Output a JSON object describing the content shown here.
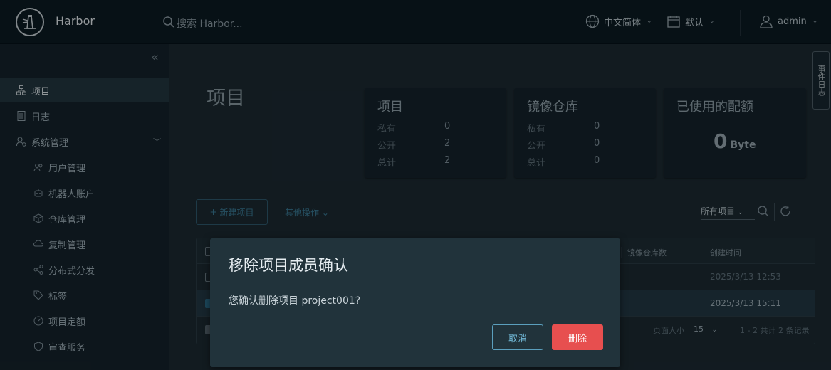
{
  "header": {
    "brand": "Harbor",
    "search_placeholder": "搜索 Harbor...",
    "language": "中文简体",
    "datetime_format": "默认",
    "user": "admin"
  },
  "sidebar": {
    "items": [
      {
        "label": "项目",
        "icon": "projects-icon",
        "active": true
      },
      {
        "label": "日志",
        "icon": "logs-icon"
      },
      {
        "label": "系统管理",
        "icon": "admin-icon",
        "expandable": true
      },
      {
        "label": "用户管理",
        "icon": "users-icon",
        "sub": true
      },
      {
        "label": "机器人账户",
        "icon": "robot-icon",
        "sub": true
      },
      {
        "label": "仓库管理",
        "icon": "registry-icon",
        "sub": true
      },
      {
        "label": "复制管理",
        "icon": "replication-icon",
        "sub": true
      },
      {
        "label": "分布式分发",
        "icon": "distribution-icon",
        "sub": true
      },
      {
        "label": "标签",
        "icon": "tag-icon",
        "sub": true
      },
      {
        "label": "项目定额",
        "icon": "quota-icon",
        "sub": true
      },
      {
        "label": "审查服务",
        "icon": "shield-icon",
        "sub": true
      }
    ]
  },
  "main": {
    "title": "项目",
    "cards": {
      "projects": {
        "title": "项目",
        "rows": [
          {
            "label": "私有",
            "value": "0"
          },
          {
            "label": "公开",
            "value": "2"
          },
          {
            "label": "总计",
            "value": "2"
          }
        ]
      },
      "repos": {
        "title": "镜像仓库",
        "rows": [
          {
            "label": "私有",
            "value": "0"
          },
          {
            "label": "公开",
            "value": "0"
          },
          {
            "label": "总计",
            "value": "0"
          }
        ]
      },
      "quota": {
        "title": "已使用的配额",
        "value": "0",
        "unit": "Byte"
      }
    },
    "new_project": "新建项目",
    "other_ops": "其他操作",
    "filter": "所有项目",
    "side_tab": "事件日志",
    "table": {
      "headers": [
        "镜像仓库数",
        "创建时间"
      ],
      "rows": [
        {
          "created": "2025/3/13 12:53",
          "selected": false
        },
        {
          "created": "2025/3/13 15:11",
          "selected": true
        }
      ],
      "page_size_label": "页面大小",
      "page_size": "15",
      "summary": "1 - 2 共计 2 条记录"
    }
  },
  "modal": {
    "title": "移除项目成员确认",
    "body": "您确认删除项目 project001?",
    "cancel": "取消",
    "delete": "删除"
  },
  "colors": {
    "accent": "#3b7d99",
    "danger": "#e74f4f"
  }
}
